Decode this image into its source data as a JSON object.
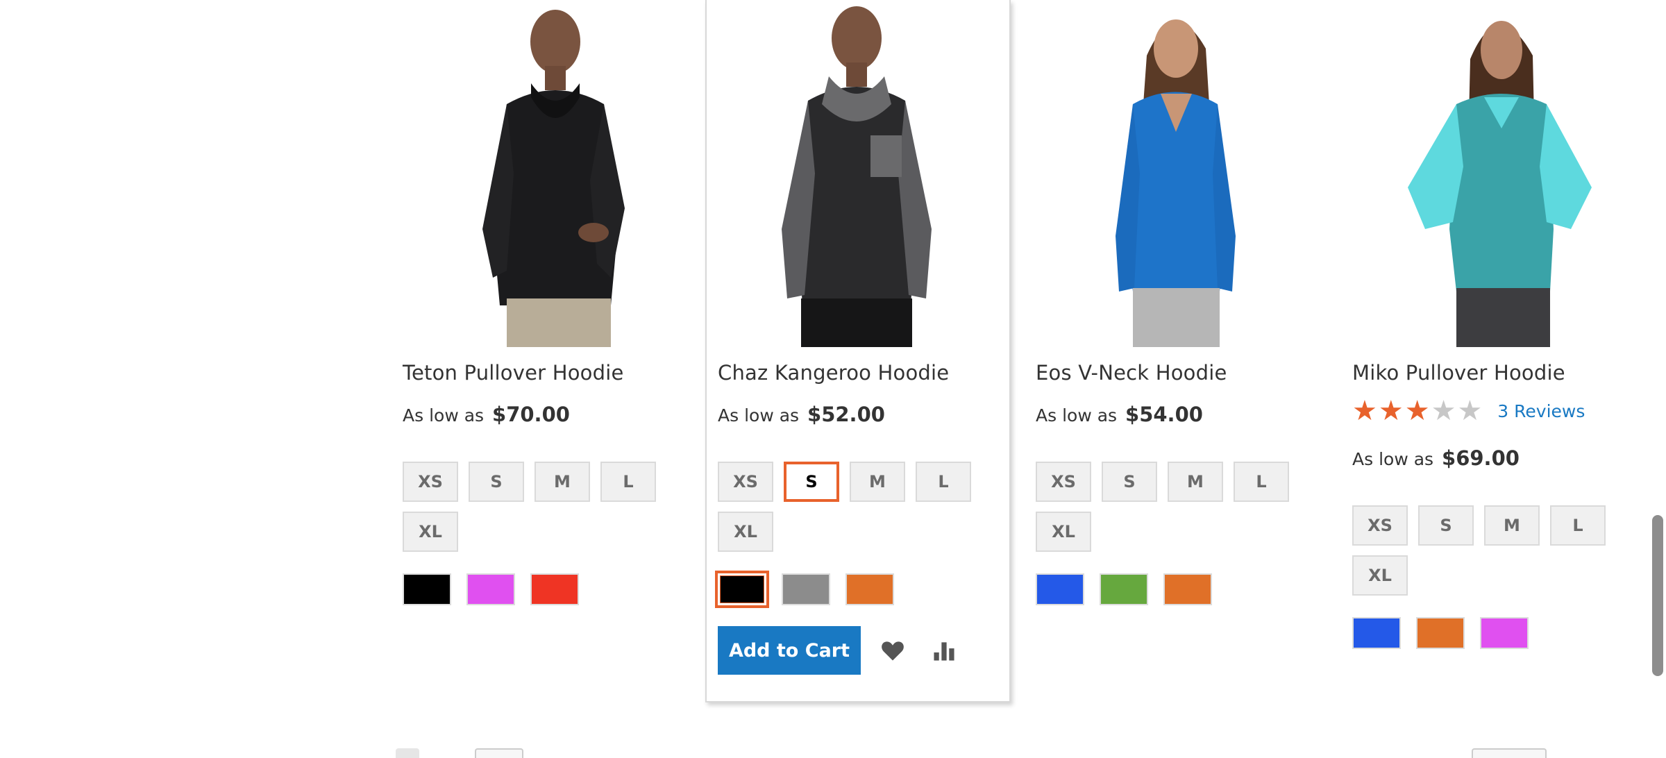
{
  "colors": {
    "accent": "#e8622c",
    "link": "#1979c3",
    "button": "#1979c3"
  },
  "products": [
    {
      "name": "Teton Pullover Hoodie",
      "price_prefix": "As low as",
      "price": "$70.00",
      "sizes": [
        "XS",
        "S",
        "M",
        "L",
        "XL"
      ],
      "selected_size": null,
      "swatches": [
        "#000000",
        "#e050f0",
        "#ef3424"
      ],
      "selected_swatch": null,
      "image": "man-black-hoodie"
    },
    {
      "name": "Chaz Kangeroo Hoodie",
      "price_prefix": "As low as",
      "price": "$52.00",
      "sizes": [
        "XS",
        "S",
        "M",
        "L",
        "XL"
      ],
      "selected_size": "S",
      "swatches": [
        "#000000",
        "#8c8c8c",
        "#e07028"
      ],
      "selected_swatch": 0,
      "image": "man-gray-hoodie",
      "add_to_cart": "Add to Cart",
      "wishlist_icon": "heart-icon",
      "compare_icon": "bar-chart-icon"
    },
    {
      "name": "Eos V-Neck Hoodie",
      "price_prefix": "As low as",
      "price": "$54.00",
      "sizes": [
        "XS",
        "S",
        "M",
        "L",
        "XL"
      ],
      "selected_size": null,
      "swatches": [
        "#2459e8",
        "#66a83e",
        "#e07028"
      ],
      "selected_swatch": null,
      "image": "woman-blue-hoodie"
    },
    {
      "name": "Miko Pullover Hoodie",
      "rating": 3,
      "rating_max": 5,
      "reviews": "3 Reviews",
      "price_prefix": "As low as",
      "price": "$69.00",
      "sizes": [
        "XS",
        "S",
        "M",
        "L",
        "XL"
      ],
      "selected_size": null,
      "swatches": [
        "#2459e8",
        "#e07028",
        "#e050f0"
      ],
      "selected_swatch": null,
      "image": "woman-teal-hoodie"
    }
  ]
}
